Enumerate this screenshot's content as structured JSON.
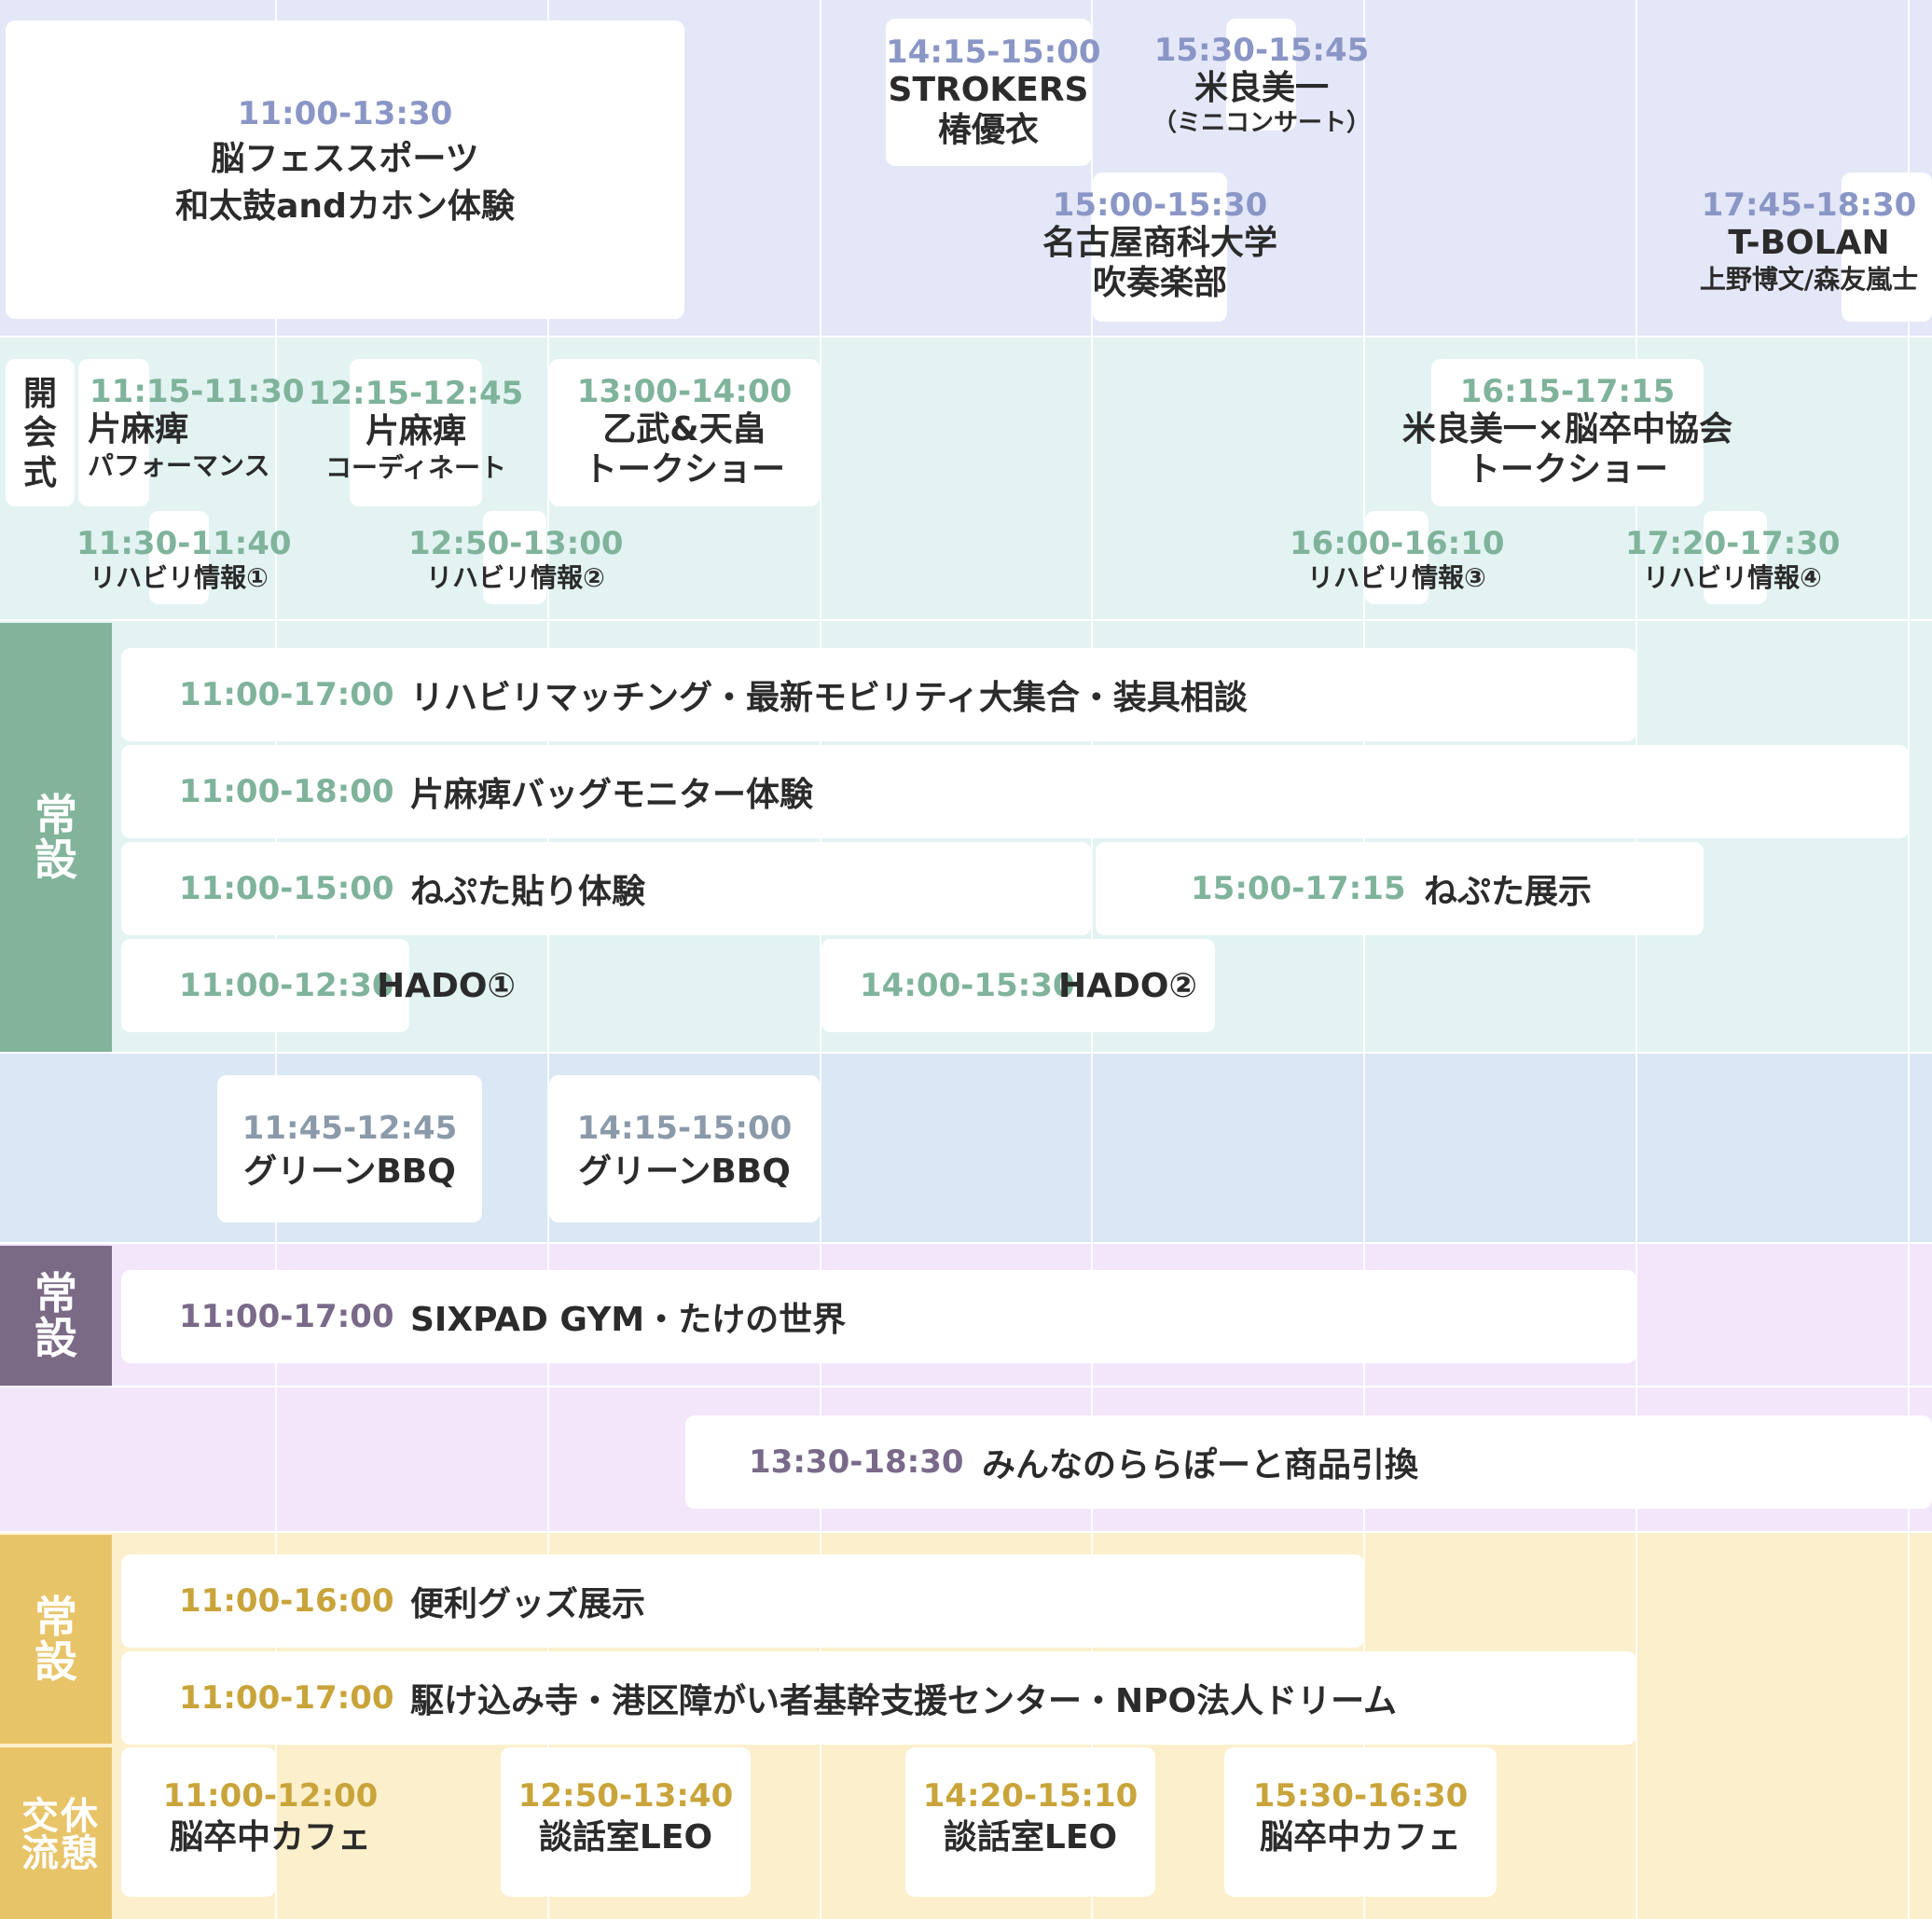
{
  "colors": {
    "stage_band": "#e4e7f7",
    "talk_band": "#e2f3f2",
    "permanent_teal_band": "#e2f3f2",
    "permanent_teal_label": "#82b49b",
    "bbq_band": "#dae7f4",
    "permanent_purple_band": "#f3e6fa",
    "permanent_purple_label": "#7b6a86",
    "purple_band2": "#f3e6fa",
    "permanent_gold_band": "#fcefcc",
    "permanent_gold_label": "#e8c469",
    "time_blue": "#8a96c6",
    "time_teal": "#7fb39b",
    "time_slate": "#8b9aaa",
    "time_purple": "#7a6a8a",
    "time_gold": "#c9a43a"
  },
  "stage": {
    "ev1": {
      "time": "11:00-13:30",
      "line1": "脳フェススポーツ",
      "line2": "和太鼓andカホン体験"
    },
    "ev2": {
      "time": "14:15-15:00",
      "line1": "STROKERS",
      "line2": "椿優衣"
    },
    "ev3": {
      "time": "15:30-15:45",
      "line1": "米良美一",
      "sub": "（ミニコンサート）"
    },
    "ev4": {
      "time": "15:00-15:30",
      "line1": "名古屋商科大学",
      "line2": "吹奏楽部"
    },
    "ev5": {
      "time": "17:45-18:30",
      "line1": "T-BOLAN",
      "sub": "上野博文/森友嵐士"
    }
  },
  "talk": {
    "opening": {
      "c1": "開",
      "c2": "会",
      "c3": "式"
    },
    "ev1": {
      "time": "11:15-11:30",
      "line1": "片麻痺",
      "sub": "パフォーマンス"
    },
    "ev2": {
      "time": "12:15-12:45",
      "line1": "片麻痺",
      "sub": "コーディネート"
    },
    "ev3": {
      "time": "13:00-14:00",
      "line1": "乙武&天畠",
      "line2": "トークショー"
    },
    "ev4": {
      "time": "16:15-17:15",
      "line1": "米良美一×脳卒中協会",
      "line2": "トークショー"
    },
    "info1": {
      "time": "11:30-11:40",
      "sub": "リハビリ情報①"
    },
    "info2": {
      "time": "12:50-13:00",
      "sub": "リハビリ情報②"
    },
    "info3": {
      "time": "16:00-16:10",
      "sub": "リハビリ情報③"
    },
    "info4": {
      "time": "17:20-17:30",
      "sub": "リハビリ情報④"
    }
  },
  "permanent_teal": {
    "label1": "常",
    "label2": "設",
    "row1": {
      "time": "11:00-17:00",
      "name": "リハビリマッチング・最新モビリティ大集合・装具相談"
    },
    "row2": {
      "time": "11:00-18:00",
      "name": "片麻痺バッグモニター体験"
    },
    "row3a": {
      "time": "11:00-15:00",
      "name": "ねぷた貼り体験"
    },
    "row3b": {
      "time": "15:00-17:15",
      "name": "ねぷた展示"
    },
    "row4a": {
      "time": "11:00-12:30",
      "name": "HADO①"
    },
    "row4b": {
      "time": "14:00-15:30",
      "name": "HADO②"
    }
  },
  "bbq": {
    "ev1": {
      "time": "11:45-12:45",
      "name": "グリーンBBQ"
    },
    "ev2": {
      "time": "14:15-15:00",
      "name": "グリーンBBQ"
    }
  },
  "permanent_purple": {
    "label1": "常",
    "label2": "設",
    "row1": {
      "time": "11:00-17:00",
      "name": "SIXPAD GYM・たけの世界"
    }
  },
  "purple2": {
    "row1": {
      "time": "13:30-18:30",
      "name": "みんなのららぽーと商品引換"
    }
  },
  "permanent_gold": {
    "label1": "常",
    "label2": "設",
    "row1": {
      "time": "11:00-16:00",
      "name": "便利グッズ展示"
    },
    "row2": {
      "time": "11:00-17:00",
      "name": "駆け込み寺・港区障がい者基幹支援センター・NPO法人ドリーム"
    }
  },
  "rest": {
    "label_col1": "交流",
    "label_col2": "休憩",
    "ev1": {
      "time": "11:00-12:00",
      "name": "脳卒中カフェ"
    },
    "ev2": {
      "time": "12:50-13:40",
      "name": "談話室LEO"
    },
    "ev3": {
      "time": "14:20-15:10",
      "name": "談話室LEO"
    },
    "ev4": {
      "time": "15:30-16:30",
      "name": "脳卒中カフェ"
    }
  }
}
